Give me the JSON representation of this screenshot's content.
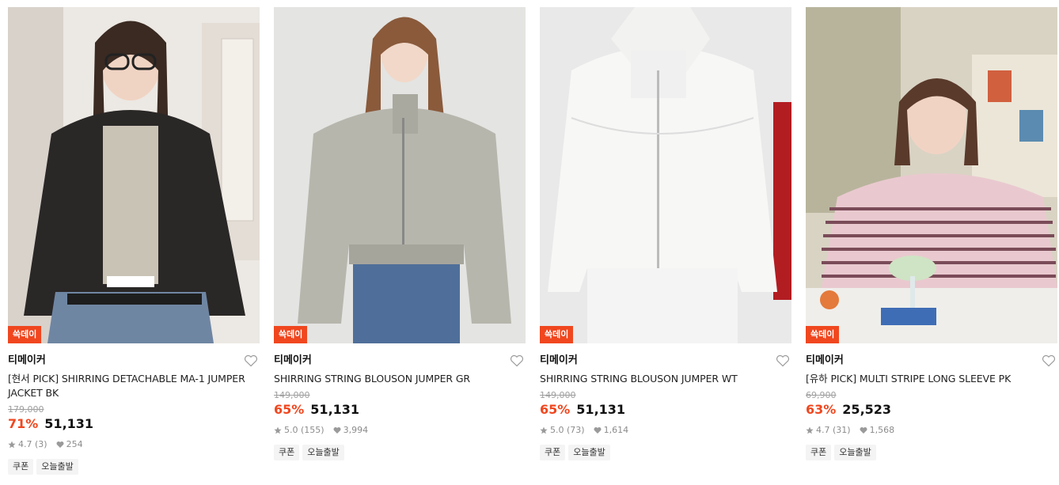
{
  "products": [
    {
      "badge": "쓱데이",
      "brand": "티메이커",
      "title": "[현서 PICK] SHIRRING DETACHABLE MA-1 JUMPER JACKET BK",
      "original_price": "179,000",
      "discount": "71%",
      "price": "51,131",
      "rating": "4.7",
      "reviews": "(3)",
      "likes": "254",
      "tags": [
        "쿠폰",
        "오늘출발"
      ],
      "image_desc": "model in black bomber jacket"
    },
    {
      "badge": "쓱데이",
      "brand": "티메이커",
      "title": "SHIRRING STRING BLOUSON JUMPER GR",
      "original_price": "149,000",
      "discount": "65%",
      "price": "51,131",
      "rating": "5.0",
      "reviews": "(155)",
      "likes": "3,994",
      "tags": [
        "쿠폰",
        "오늘출발"
      ],
      "image_desc": "model in grey blouson jumper"
    },
    {
      "badge": "쓱데이",
      "brand": "티메이커",
      "title": "SHIRRING STRING BLOUSON JUMPER WT",
      "original_price": "149,000",
      "discount": "65%",
      "price": "51,131",
      "rating": "5.0",
      "reviews": "(73)",
      "likes": "1,614",
      "tags": [
        "쿠폰",
        "오늘출발"
      ],
      "image_desc": "model in white blouson jumper"
    },
    {
      "badge": "쓱데이",
      "brand": "티메이커",
      "title": "[유하 PICK] MULTI STRIPE LONG SLEEVE PK",
      "original_price": "69,900",
      "discount": "63%",
      "price": "25,523",
      "rating": "4.7",
      "reviews": "(31)",
      "likes": "1,568",
      "tags": [
        "쿠폰",
        "오늘출발"
      ],
      "image_desc": "model in pink striped long sleeve"
    }
  ],
  "colors": {
    "accent": "#f0471f",
    "muted": "#8c8c8c"
  },
  "icons": {
    "wishlist": "heart-outline-icon",
    "rating": "star-icon",
    "likes": "heart-icon"
  }
}
